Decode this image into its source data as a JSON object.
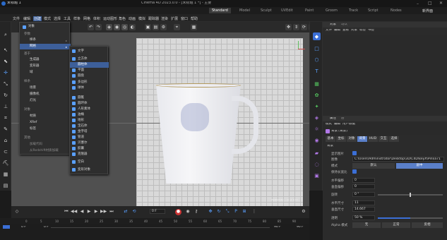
{
  "title_bar": {
    "app_title": "Cinema 4D 2023.0.0 - [未标题 1 *] - 主要",
    "tab_label": "未标题 1"
  },
  "layouts": [
    "Standard",
    "Model",
    "Sculpt",
    "UVEdit",
    "Paint",
    "Groom",
    "Track",
    "Script",
    "Nodes"
  ],
  "layout_extra": "新界面",
  "main_menu": [
    "文件",
    "编辑",
    "创建",
    "模式",
    "选择",
    "工具",
    "样条",
    "网格",
    "体积",
    "运动图形",
    "角色",
    "动画",
    "模拟",
    "跟踪器",
    "渲染",
    "扩展",
    "窗口",
    "帮助"
  ],
  "create_menu": {
    "items": [
      {
        "label": "对象",
        "icon": "cube-icon"
      },
      {
        "label": "样条",
        "has_sub": true
      },
      {
        "label": "网格",
        "has_sub": true,
        "highlight": true
      },
      {
        "label": "生成器",
        "has_sub": true
      },
      {
        "label": "变形器",
        "has_sub": true
      },
      {
        "label": "域",
        "has_sub": true
      },
      {
        "label": "场景",
        "has_sub": true
      },
      {
        "label": "摄像机",
        "has_sub": true
      },
      {
        "label": "灯光",
        "has_sub": true
      },
      {
        "label": "材质",
        "has_sub": true
      },
      {
        "label": "XRef",
        "has_sub": true
      },
      {
        "label": "标签",
        "has_sub": true
      },
      {
        "label": "加载代码",
        "has_sub": false
      },
      {
        "label": "从Redshift材质加载",
        "has_sub": false
      }
    ],
    "section_labels": [
      "参数",
      "基于",
      "样条",
      "对象",
      "其他"
    ]
  },
  "mesh_submenu": {
    "items": [
      "文字",
      "立方体",
      "圆柱体",
      "平面",
      "圆盘",
      "多边形",
      "球体",
      "圆锥",
      "圆环体",
      "人形素体",
      "油桶",
      "地形",
      "宝石体",
      "金字塔",
      "管道",
      "贝塞尔",
      "胶囊",
      "克隆器",
      "空白",
      "变形对象"
    ]
  },
  "viewport": {
    "info": "网格间距 : 0.5 cm",
    "axis_labels": [
      "x",
      "y"
    ]
  },
  "timeline": {
    "frame": "0 F",
    "start": "0 F",
    "end": "90 F",
    "end2": "90 F",
    "ticks": [
      "0",
      "5",
      "10",
      "15",
      "20",
      "25",
      "30",
      "35",
      "40",
      "45",
      "50",
      "55",
      "60",
      "65",
      "70",
      "75",
      "80",
      "85",
      "90"
    ]
  },
  "right_panel": {
    "tabs_top": [
      "对象",
      "场次"
    ],
    "menu_top": [
      "文件",
      "编辑",
      "查看",
      "对象",
      "标签",
      "书签"
    ],
    "attr_tabs": [
      "属性",
      "层"
    ],
    "attr_menu": [
      "模式",
      "编辑",
      "用户数据"
    ],
    "object_name": "背景 [背景]",
    "attr_subtabs": [
      "基本",
      "坐标",
      "对象",
      "背景",
      "HUD",
      "交互",
      "选择"
    ],
    "section": "背景",
    "rows": [
      {
        "label": "显示图片",
        "type": "check"
      },
      {
        "label": "图像",
        "value": "C:\\Users\\Administrator\\Desktop\\3D\\C4D\\keyX\\Pin\\ia71"
      },
      {
        "label": "模式",
        "value": "默认",
        "value2": "居中"
      },
      {
        "label": "保持长宽比",
        "type": "check"
      },
      {
        "label": "水平偏移",
        "value": "0"
      },
      {
        "label": "垂直偏移",
        "value": "0"
      },
      {
        "label": "旋转",
        "value": "0 °"
      },
      {
        "label": "水平尺寸",
        "value": "11"
      },
      {
        "label": "垂直尺寸",
        "value": "14.667"
      },
      {
        "label": "透明",
        "value": "50 %"
      },
      {
        "label": "Alpha 模式",
        "value": "无",
        "value2": "正常",
        "value3": "反相"
      }
    ],
    "transparency_percent": 50
  },
  "colors": {
    "accent": "#3b6fd6",
    "viewport_bg": "#505050",
    "menu_hl": "#3d5f9a"
  }
}
